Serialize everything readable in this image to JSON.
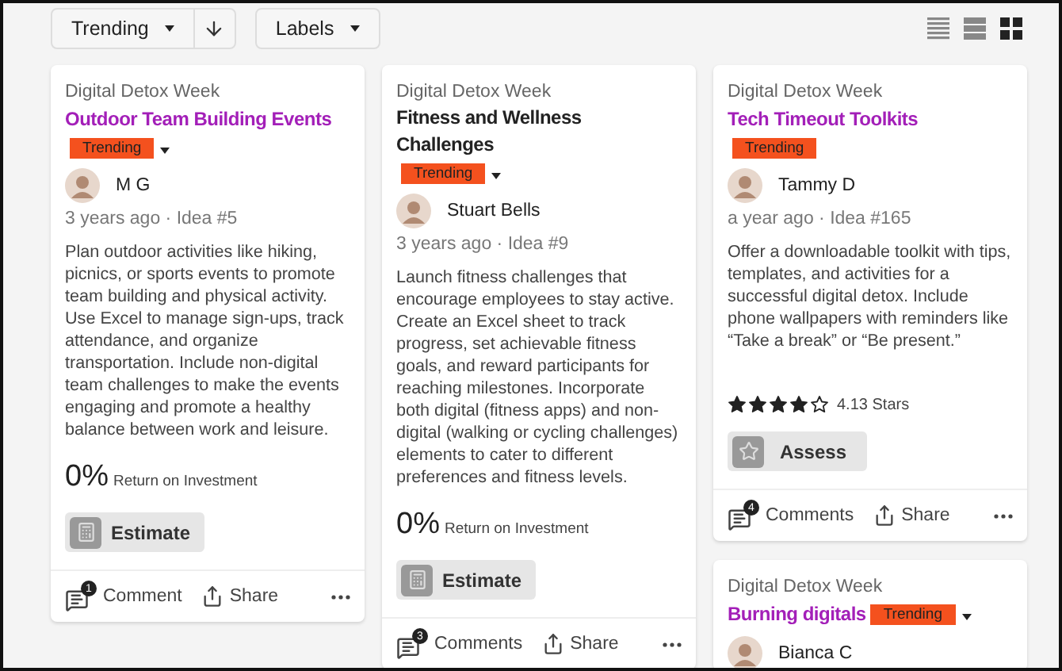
{
  "toolbar": {
    "sort": {
      "label": "Trending"
    },
    "labels": {
      "label": "Labels"
    },
    "views": [
      {
        "kind": "list",
        "selected": false
      },
      {
        "kind": "rows",
        "selected": false
      },
      {
        "kind": "grid",
        "selected": true
      }
    ]
  },
  "columns": [
    {
      "cards": [
        {
          "project": "Digital Detox Week",
          "title": "Outdoor Team Building Events",
          "highlighted": true,
          "tag": "Trending",
          "tag_menu": true,
          "author": "M G",
          "meta": "3 years ago · Idea #5",
          "description": "Plan outdoor activities like hiking, picnics, or sports events to promote team building and physical activity. Use Excel to manage sign-ups, track attendance, and organize transportation. Include non-digital team challenges to make the events engaging and promote a healthy balance between work and leisure.",
          "metric": {
            "kind": "roi",
            "value": "0%",
            "label": "Return on Investment"
          },
          "action": {
            "kind": "estimate",
            "label": "Estimate"
          },
          "footer": {
            "count": "1",
            "comment": "Comment",
            "share": "Share"
          }
        }
      ]
    },
    {
      "cards": [
        {
          "project": "Digital Detox Week",
          "title": "Fitness and Wellness Challenges",
          "highlighted": false,
          "tag": "Trending",
          "tag_menu": true,
          "author": "Stuart Bells",
          "meta": "3 years ago · Idea #9",
          "description": "Launch fitness challenges that encourage employees to stay active. Create an Excel sheet to track progress, set achievable fitness goals, and reward participants for reaching milestones. Incorporate both digital (fitness apps) and non-digital (walking or cycling challenges) elements to cater to different preferences and fitness levels.",
          "metric": {
            "kind": "roi",
            "value": "0%",
            "label": "Return on Investment"
          },
          "action": {
            "kind": "estimate",
            "label": "Estimate"
          },
          "footer": {
            "count": "3",
            "comment": "Comments",
            "share": "Share"
          }
        }
      ]
    },
    {
      "cards": [
        {
          "project": "Digital Detox Week",
          "title": "Tech Timeout Toolkits",
          "highlighted": true,
          "tag": "Trending",
          "tag_menu": false,
          "author": "Tammy D",
          "meta": "a year ago · Idea #165",
          "description": "Offer a downloadable toolkit with tips, templates, and activities for a successful digital detox. Include phone wallpapers with reminders like “Take a break” or “Be present.”",
          "metric": {
            "kind": "stars",
            "stars": 4,
            "label": "4.13 Stars"
          },
          "action": {
            "kind": "assess",
            "label": "Assess"
          },
          "footer": {
            "count": "4",
            "comment": "Comments",
            "share": "Share"
          }
        },
        {
          "project": "Digital Detox Week",
          "title": "Burning digitals",
          "highlighted": true,
          "tag": "Trending",
          "tag_menu": true,
          "author": "Bianca C"
        }
      ]
    }
  ]
}
